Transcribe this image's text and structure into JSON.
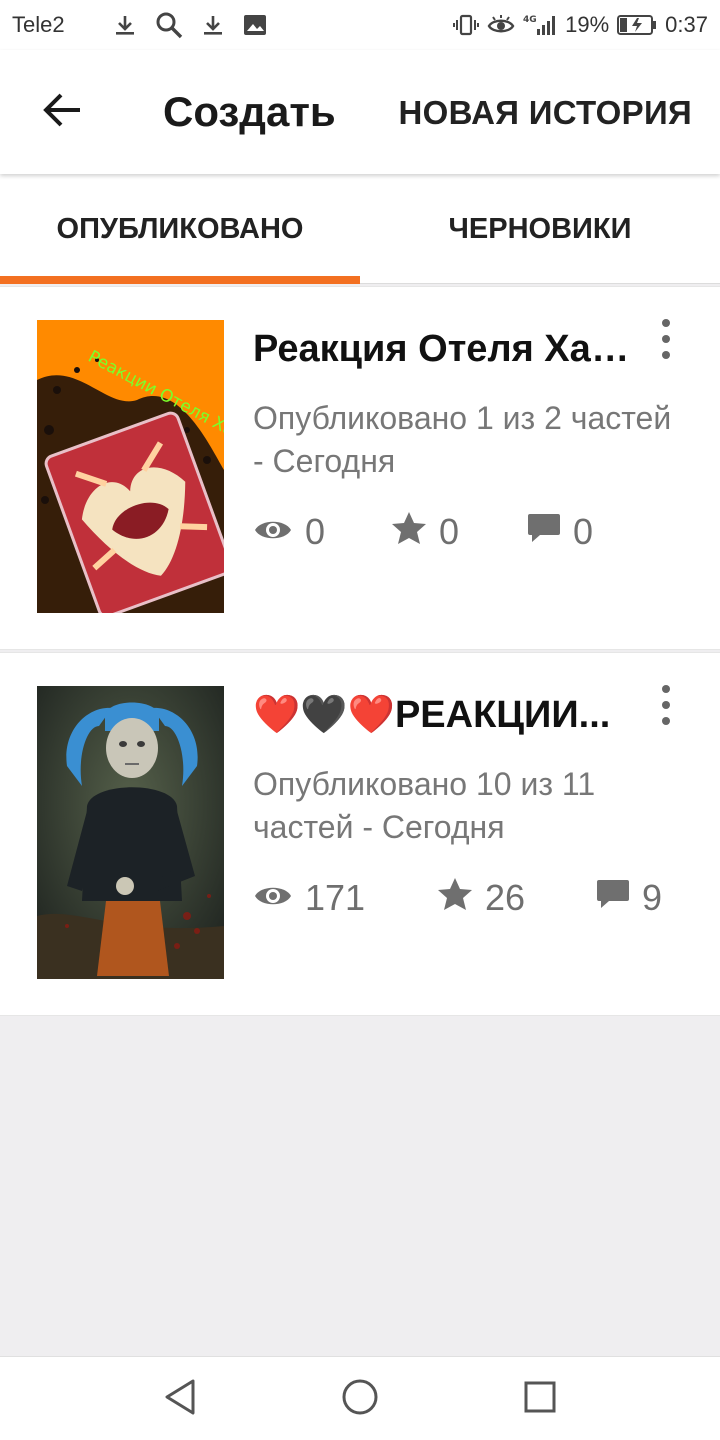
{
  "status_bar": {
    "carrier": "Tele2",
    "battery": "19%",
    "time": "0:37",
    "left_icons": [
      "download-icon",
      "search-icon",
      "download-icon",
      "image-icon"
    ],
    "right_icons": [
      "vibrate-icon",
      "eye-icon",
      "signal-4g-icon",
      "battery-charging-icon"
    ]
  },
  "app_bar": {
    "title": "Создать",
    "action_label": "НОВАЯ ИСТОРИЯ",
    "back_icon": "arrow-left-icon"
  },
  "tabs": [
    {
      "label": "ОПУБЛИКОВАНО",
      "selected": true
    },
    {
      "label": "ЧЕРНОВИКИ",
      "selected": false
    }
  ],
  "accent_color": "#f37021",
  "stories": [
    {
      "title": "Реакция Отеля Хазбин",
      "cover_text": "Реакции Отеля Хазбин",
      "meta": "Опубликовано 1 из 2 частей - Сегодня",
      "views": "0",
      "votes": "0",
      "comments": "0"
    },
    {
      "title": "❤️🖤❤️РЕАКЦИИ...",
      "meta": "Опубликовано 10 из 11 частей - Сегодня",
      "views": "171",
      "votes": "26",
      "comments": "9"
    }
  ],
  "nav_bar": {
    "icons": [
      "back-triangle-icon",
      "home-circle-icon",
      "recents-square-icon"
    ]
  }
}
